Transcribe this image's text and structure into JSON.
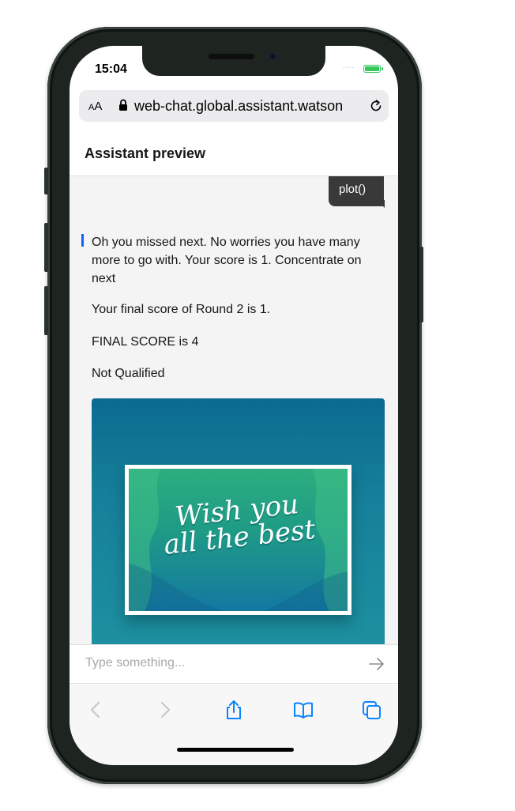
{
  "status_bar": {
    "time": "15:04",
    "signal": "....",
    "battery_color": "#34c759"
  },
  "browser": {
    "text_size_label_small": "A",
    "text_size_label_large": "A",
    "url": "web-chat.global.assistant.watson",
    "icons": [
      "lock-icon",
      "reload-icon"
    ]
  },
  "chat_header": {
    "title": "Assistant preview"
  },
  "chat": {
    "user_message": "plot()",
    "bot_messages": [
      "Oh you missed next. No worries you have many more to go with. Your score is 1. Concentrate on next",
      "Your final score of Round 2 is 1.",
      "FINAL SCORE is 4",
      "Not Qualified"
    ],
    "image_card": {
      "art_line1": "Wish you",
      "art_line2": "all the best"
    },
    "accent_color": "#0f62fe"
  },
  "composer": {
    "placeholder": "Type something...",
    "send_icon": "arrow-right-icon"
  },
  "toolbar": {
    "icons": [
      "back-icon",
      "forward-icon",
      "share-icon",
      "bookmarks-icon",
      "tabs-icon"
    ],
    "active_color": "#0a84ff",
    "disabled_color": "#c7c7cc"
  }
}
